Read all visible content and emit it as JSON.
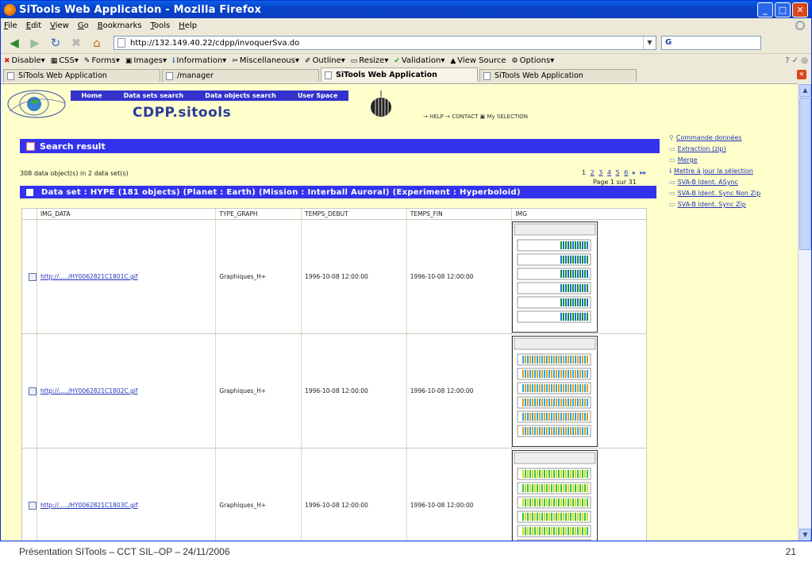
{
  "window": {
    "title": "SiTools Web Application - Mozilla Firefox"
  },
  "menu": [
    "File",
    "Edit",
    "View",
    "Go",
    "Bookmarks",
    "Tools",
    "Help"
  ],
  "nav": {
    "url": "http://132.149.40.22/cdpp/invoquerSva.do",
    "search_value": "G"
  },
  "devbar": [
    "Disable",
    "CSS",
    "Forms",
    "Images",
    "Information",
    "Miscellaneous",
    "Outline",
    "Resize",
    "Validation",
    "View Source",
    "Options"
  ],
  "tabs": [
    "SiTools Web Application",
    "/manager",
    "SiTools Web Application",
    "SiTools Web Application"
  ],
  "site": {
    "nav_links": [
      "Home",
      "Data sets search",
      "Data objects search",
      "User Space"
    ],
    "title": "CDPP.sitools",
    "help_links": "→ HELP → CONTACT ▣ My SELECTION"
  },
  "result": {
    "heading": "Search result",
    "count_text": "308 data object(s) in 2 data set(s)",
    "pager_prefix": "1",
    "pager_pages": [
      "2",
      "3",
      "4",
      "5",
      "6"
    ],
    "page_of": "Page 1 sur 31",
    "dataset": "Data set : HYPE  (181 objects)  (Planet : Earth)  (Mission : Interball Auroral)  (Experiment : Hyperboloid)"
  },
  "table": {
    "headers": [
      "IMG_DATA",
      "TYPE_GRAPH",
      "TEMPS_DEBUT",
      "TEMPS_FIN",
      "IMG"
    ],
    "rows": [
      {
        "link": "http://...../HY0062821C1801C.gif",
        "type": "Graphiques_H+",
        "start": "1996-10-08 12:00:00",
        "end": "1996-10-08 12:00:00"
      },
      {
        "link": "http://...../HY0062821C1802C.gif",
        "type": "Graphiques_H+",
        "start": "1996-10-08 12:00:00",
        "end": "1996-10-08 12:00:00"
      },
      {
        "link": "http://...../HY0062821C1803C.gif",
        "type": "Graphiques_H+",
        "start": "1996-10-08 12:00:00",
        "end": "1996-10-08 12:00:00"
      }
    ]
  },
  "side_links": [
    "Commande données",
    "Extraction (zip)",
    "Merge",
    "Mettre à jour la sélection",
    "SVA-B Ident. ASync",
    "SVA-B Ident. Sync Non Zip",
    "SVA-B Ident. Sync Zip"
  ],
  "footer": {
    "text": "Présentation SITools – CCT SIL–OP – 24/11/2006",
    "page": "21"
  },
  "colors": {
    "accent": "#3333ee",
    "page_bg": "#ffffcc",
    "link": "#2233bb"
  }
}
